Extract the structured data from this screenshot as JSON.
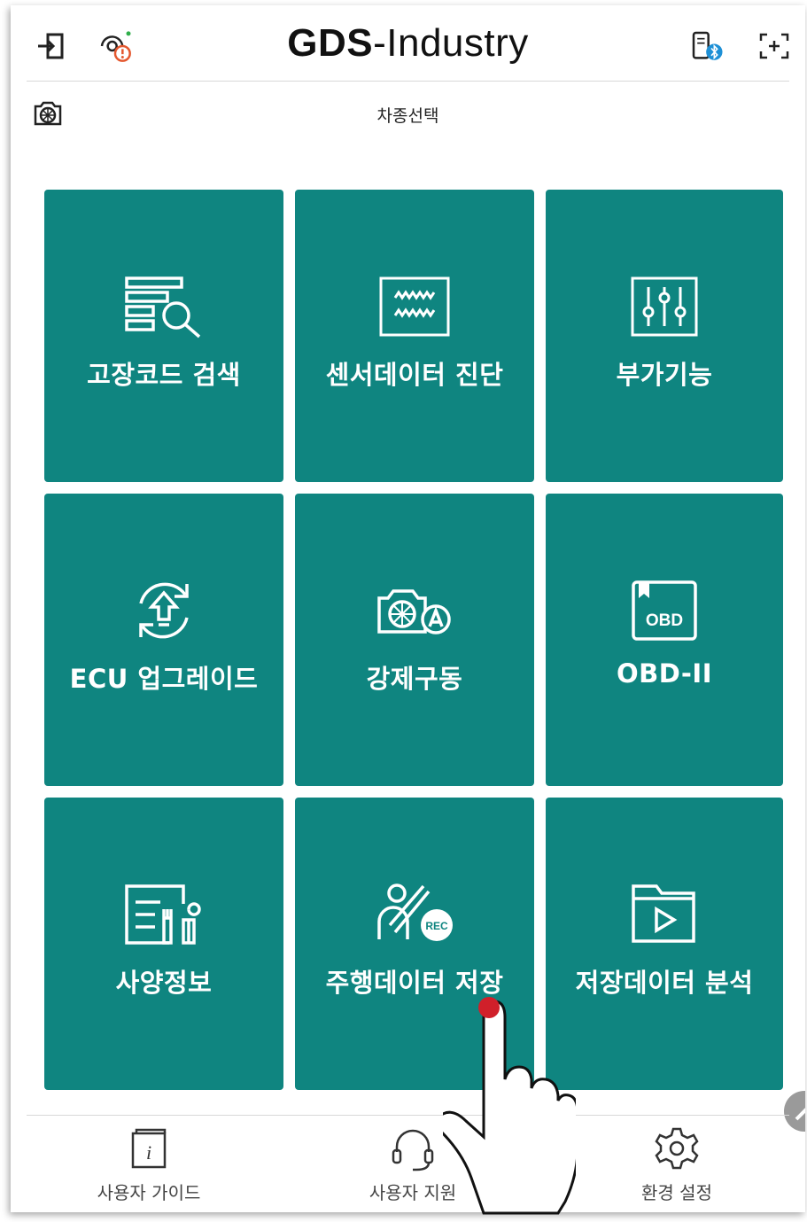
{
  "header": {
    "logo_part1": "G",
    "logo_part2": "DS",
    "logo_part3": "-Industry",
    "icons": [
      "exit-icon",
      "engine-warning-icon",
      "bluetooth-device-icon",
      "fullscreen-icon"
    ]
  },
  "subheader": {
    "label": "차종선택",
    "icon": "vehicle-select-icon"
  },
  "tiles": [
    {
      "label": "고장코드 검색",
      "icon": "dtc-search-icon"
    },
    {
      "label": "센서데이터 진단",
      "icon": "sensor-data-icon"
    },
    {
      "label": "부가기능",
      "icon": "sliders-icon"
    },
    {
      "label": "ECU 업그레이드",
      "icon": "ecu-upgrade-icon"
    },
    {
      "label": "강제구동",
      "icon": "actuation-test-icon"
    },
    {
      "label": "OBD-II",
      "icon": "obd-icon",
      "icon_text": "OBD"
    },
    {
      "label": "사양정보",
      "icon": "spec-info-icon"
    },
    {
      "label": "주행데이터 저장",
      "icon": "drive-record-icon",
      "icon_text": "REC"
    },
    {
      "label": "저장데이터 분석",
      "icon": "saved-data-folder-icon"
    }
  ],
  "bottom_nav": [
    {
      "label": "사용자 가이드",
      "icon": "user-guide-icon"
    },
    {
      "label": "사용자 지원",
      "icon": "headset-icon"
    },
    {
      "label": "환경 설정",
      "icon": "settings-gear-icon"
    }
  ],
  "colors": {
    "tile": "#0f8580",
    "warning": "#e4572e",
    "status_dot": "#2fae4a",
    "bluetooth": "#1e90d6",
    "touch_dot": "#d0202a"
  }
}
